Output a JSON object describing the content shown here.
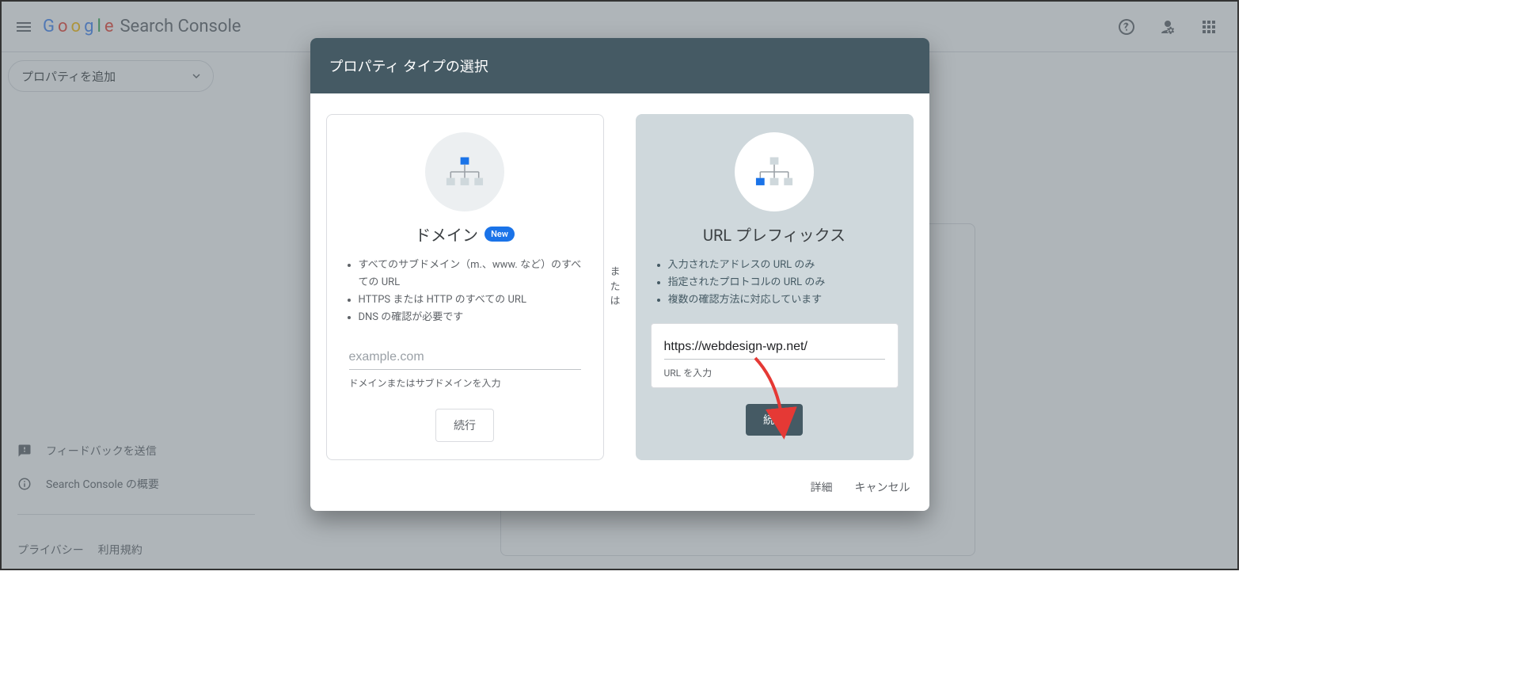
{
  "header": {
    "logo_letters": [
      "G",
      "o",
      "o",
      "g",
      "l",
      "e"
    ],
    "product_name": "Search Console"
  },
  "sidebar": {
    "property_selector_label": "プロパティを追加",
    "feedback": "フィードバックを送信",
    "about": "Search Console の概要",
    "privacy": "プライバシー",
    "terms": "利用規約"
  },
  "dialog": {
    "title": "プロパティ タイプの選択",
    "divider_label": "または",
    "domain_card": {
      "title": "ドメイン",
      "badge": "New",
      "bullet1": "すべてのサブドメイン（m.、www. など）のすべての URL",
      "bullet2": "HTTPS または HTTP のすべての URL",
      "bullet3": "DNS の確認が必要です",
      "placeholder": "example.com",
      "hint": "ドメインまたはサブドメインを入力",
      "continue": "続行"
    },
    "url_card": {
      "title": "URL プレフィックス",
      "bullet1": "入力されたアドレスの URL のみ",
      "bullet2": "指定されたプロトコルの URL のみ",
      "bullet3": "複数の確認方法に対応しています",
      "value": "https://webdesign-wp.net/",
      "hint": "URL を入力",
      "continue": "続行"
    },
    "actions": {
      "details": "詳細",
      "cancel": "キャンセル"
    }
  }
}
